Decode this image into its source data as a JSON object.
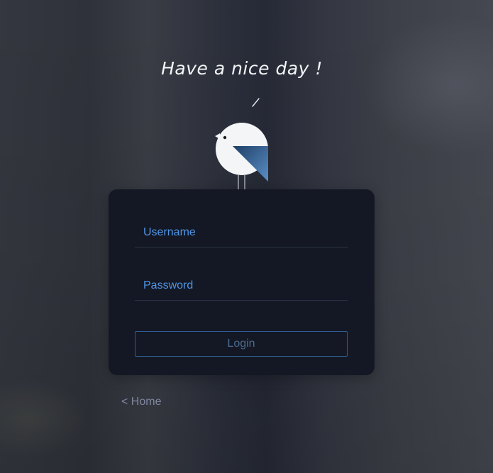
{
  "greeting": "Have a nice day !",
  "login_form": {
    "username_placeholder": "Username",
    "username_value": "",
    "password_placeholder": "Password",
    "password_value": "",
    "login_label": "Login"
  },
  "home_link": "< Home",
  "colors": {
    "accent_blue": "#4f95e6",
    "card_background": "#141824",
    "button_border": "#2f5f92",
    "link_gray": "#8088a2"
  },
  "icons": {
    "mascot": "bird-icon",
    "speech": "speech-mark-icon"
  }
}
